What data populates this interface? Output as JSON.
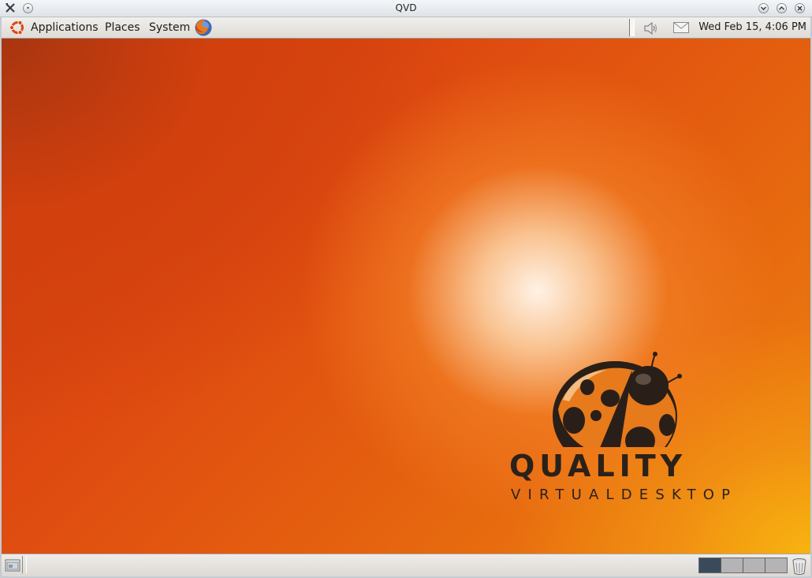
{
  "window": {
    "title": "QVD"
  },
  "top_panel": {
    "menus": [
      "Applications",
      "Places",
      "System"
    ],
    "clock": "Wed Feb 15,  4:06 PM",
    "icons": [
      "ubuntu-logo-icon",
      "firefox-icon",
      "volume-icon",
      "mail-icon"
    ]
  },
  "desktop": {
    "brand_title": "QUALITY",
    "brand_subtitle": "VIRTUALDESKTOP",
    "colors": {
      "dark_orange": "#c9380e",
      "orange": "#e5620f",
      "glow": "#fff2e6",
      "yellow": "#f7b30f",
      "logo_text": "#2b2119"
    }
  },
  "bottom_panel": {
    "workspaces": [
      {
        "active": true
      },
      {
        "active": false
      },
      {
        "active": false
      },
      {
        "active": false
      }
    ],
    "icons": [
      "show-desktop-icon",
      "trash-icon"
    ]
  }
}
